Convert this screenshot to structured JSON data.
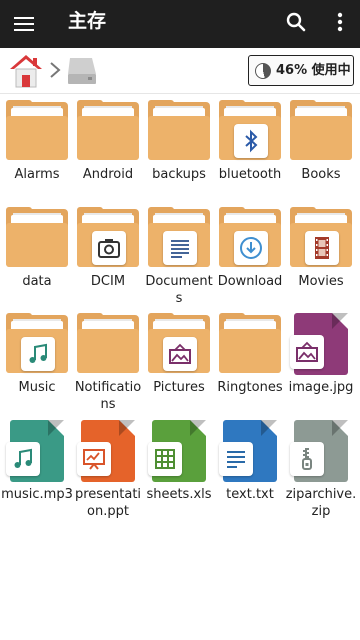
{
  "appbar": {
    "title": "主存"
  },
  "storage": {
    "usage_label": "46% 使用中",
    "usage_fraction": 0.46
  },
  "items": [
    {
      "name": "Alarms",
      "kind": "folder",
      "badge": ""
    },
    {
      "name": "Android",
      "kind": "folder",
      "badge": ""
    },
    {
      "name": "backups",
      "kind": "folder",
      "badge": ""
    },
    {
      "name": "bluetooth",
      "kind": "folder",
      "badge": "bluetooth-icon"
    },
    {
      "name": "Books",
      "kind": "folder",
      "badge": ""
    },
    {
      "name": "data",
      "kind": "folder",
      "badge": ""
    },
    {
      "name": "DCIM",
      "kind": "folder",
      "badge": "camera-icon"
    },
    {
      "name": "Documents",
      "kind": "folder",
      "badge": "document-icon"
    },
    {
      "name": "Download",
      "kind": "folder",
      "badge": "download-icon"
    },
    {
      "name": "Movies",
      "kind": "folder",
      "badge": "film-icon"
    },
    {
      "name": "Music",
      "kind": "folder",
      "badge": "music-note-icon"
    },
    {
      "name": "Notifications",
      "kind": "folder",
      "badge": ""
    },
    {
      "name": "Pictures",
      "kind": "folder",
      "badge": "picture-icon"
    },
    {
      "name": "Ringtones",
      "kind": "folder",
      "badge": ""
    },
    {
      "name": "image.jpg",
      "kind": "file",
      "badge": "picture-icon",
      "color": "#8e3a78"
    },
    {
      "name": "music.mp3",
      "kind": "file",
      "badge": "music-note-icon",
      "color": "#3a9a86"
    },
    {
      "name": "presentation.ppt",
      "kind": "file",
      "badge": "presentation-icon",
      "color": "#e5632a"
    },
    {
      "name": "sheets.xls",
      "kind": "file",
      "badge": "spreadsheet-icon",
      "color": "#5aa03c"
    },
    {
      "name": "text.txt",
      "kind": "file",
      "badge": "text-lines-icon",
      "color": "#2f78c0"
    },
    {
      "name": "ziparchive.zip",
      "kind": "file",
      "badge": "zip-icon",
      "color": "#8d9a94"
    }
  ],
  "colors": {
    "appbar": "#1f1f1f",
    "folder": "#edb26a",
    "folder_dark": "#e3a55d"
  }
}
